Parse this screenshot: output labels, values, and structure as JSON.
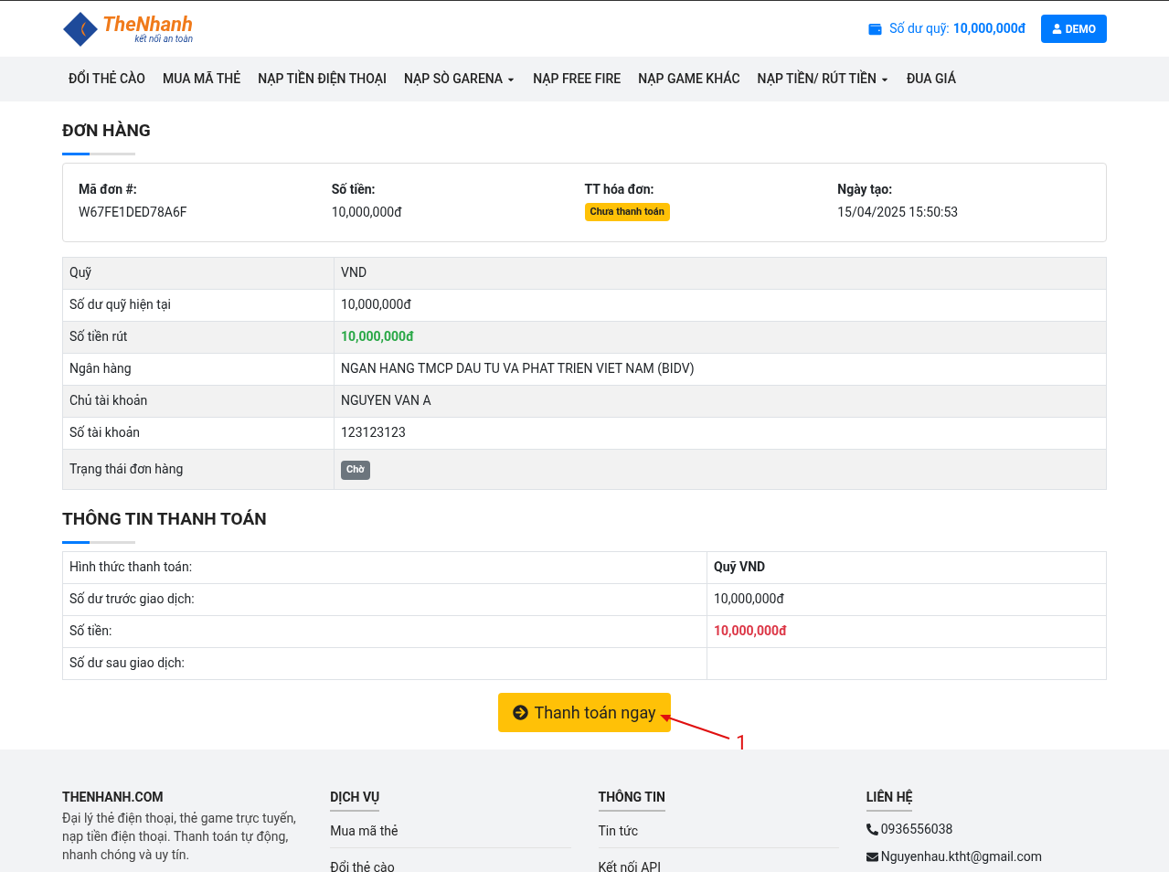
{
  "header": {
    "logo": {
      "name": "TheNhanh",
      "tagline": "kết nối an toàn"
    },
    "balance_label": "Số dư quỹ:",
    "balance_value": "10,000,000đ",
    "user_button": "DEMO"
  },
  "nav": [
    {
      "label": "ĐỔI THẺ CÀO",
      "has_dropdown": false
    },
    {
      "label": "MUA MÃ THẺ",
      "has_dropdown": false
    },
    {
      "label": "NẠP TIỀN ĐIỆN THOẠI",
      "has_dropdown": false
    },
    {
      "label": "NẠP SÒ GARENA",
      "has_dropdown": true
    },
    {
      "label": "NẠP FREE FIRE",
      "has_dropdown": false
    },
    {
      "label": "NẠP GAME KHÁC",
      "has_dropdown": false
    },
    {
      "label": "NẠP TIỀN/ RÚT TIỀN",
      "has_dropdown": true
    },
    {
      "label": "ĐUA GIÁ",
      "has_dropdown": false
    }
  ],
  "order": {
    "title": "ĐƠN HÀNG",
    "summary": [
      {
        "label": "Mã đơn #:",
        "value": "W67FE1DED78A6F",
        "kind": "text"
      },
      {
        "label": "Số tiền:",
        "value": "10,000,000đ",
        "kind": "text"
      },
      {
        "label": "TT hóa đơn:",
        "value": "Chưa thanh toán",
        "kind": "badge"
      },
      {
        "label": "Ngày tạo:",
        "value": "15/04/2025 15:50:53",
        "kind": "text"
      }
    ],
    "rows": [
      {
        "label": "Quỹ",
        "value": "VND",
        "kind": "text"
      },
      {
        "label": "Số dư quỹ hiện tại",
        "value": "10,000,000đ",
        "kind": "text"
      },
      {
        "label": "Số tiền rút",
        "value": "10,000,000đ",
        "kind": "green"
      },
      {
        "label": "Ngân hàng",
        "value": "NGAN HANG TMCP DAU TU VA PHAT TRIEN VIET NAM (BIDV)",
        "kind": "text"
      },
      {
        "label": "Chủ tài khoản",
        "value": "NGUYEN VAN A",
        "kind": "text"
      },
      {
        "label": "Số tài khoản",
        "value": "123123123",
        "kind": "text"
      },
      {
        "label": "Trạng thái đơn hàng",
        "value": "Chờ",
        "kind": "badge"
      }
    ]
  },
  "payment": {
    "title": "THÔNG TIN THANH TOÁN",
    "rows": [
      {
        "label": "Hình thức thanh toán:",
        "value": "Quỹ VND",
        "kind": "bold"
      },
      {
        "label": "Số dư trước giao dịch:",
        "value": "10,000,000đ",
        "kind": "text"
      },
      {
        "label": "Số tiền:",
        "value": "10,000,000đ",
        "kind": "red"
      },
      {
        "label": "Số dư sau giao dịch:"
      }
    ],
    "pay_button": "Thanh toán ngay",
    "annotation": "1"
  },
  "footer": {
    "about": {
      "title": "THENHANH.COM",
      "text": "Đại lý thẻ điện thoại, thẻ game trực tuyến, nạp tiền điện thoại. Thanh toán tự động, nhanh chóng và uy tín."
    },
    "columns": [
      {
        "title": "DỊCH VỤ",
        "links": [
          "Mua mã thẻ",
          "Đổi thẻ cào"
        ]
      },
      {
        "title": "THÔNG TIN",
        "links": [
          "Tin tức",
          "Kết nối API"
        ]
      }
    ],
    "contact": {
      "title": "LIÊN HỆ",
      "items": [
        {
          "kind": "phone",
          "text": "0936556038"
        },
        {
          "kind": "email",
          "text": "Nguyenhau.ktht@gmail.com"
        }
      ]
    }
  }
}
